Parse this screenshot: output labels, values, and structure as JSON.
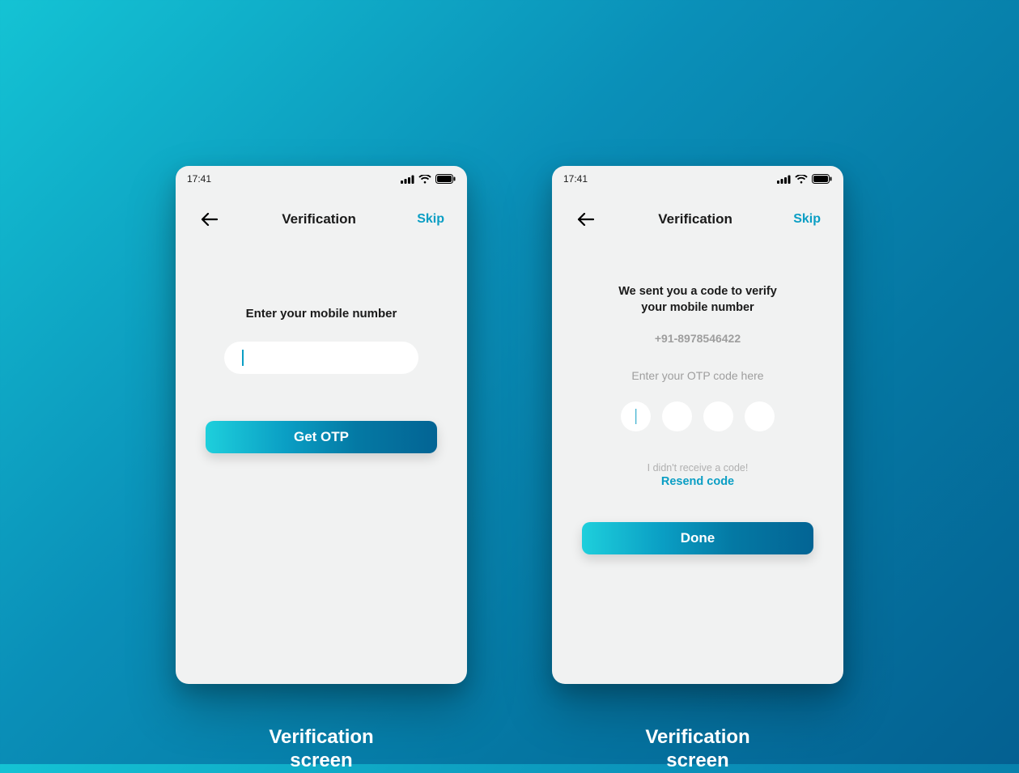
{
  "colors": {
    "accent": "#0a9ec4",
    "bg_gradient_start": "#14c3d4",
    "bg_gradient_end": "#046091",
    "phone_bg": "#f1f2f2"
  },
  "screen1": {
    "statusbar": {
      "time": "17:41"
    },
    "appbar": {
      "title": "Verification",
      "skip": "Skip"
    },
    "prompt": "Enter your mobile number",
    "input_value": "",
    "button": "Get OTP",
    "caption_line1": "Verification",
    "caption_line2": "screen"
  },
  "screen2": {
    "statusbar": {
      "time": "17:41"
    },
    "appbar": {
      "title": "Verification",
      "skip": "Skip"
    },
    "message_line1": "We sent you a code to verify",
    "message_line2": "your mobile number",
    "phone_number": "+91-8978546422",
    "otp_label": "Enter your OTP code here",
    "otp_values": [
      "",
      "",
      "",
      ""
    ],
    "no_code_text": "I didn't receive a code!",
    "resend_text": "Resend code",
    "button": "Done",
    "caption_line1": "Verification",
    "caption_line2": "screen"
  }
}
